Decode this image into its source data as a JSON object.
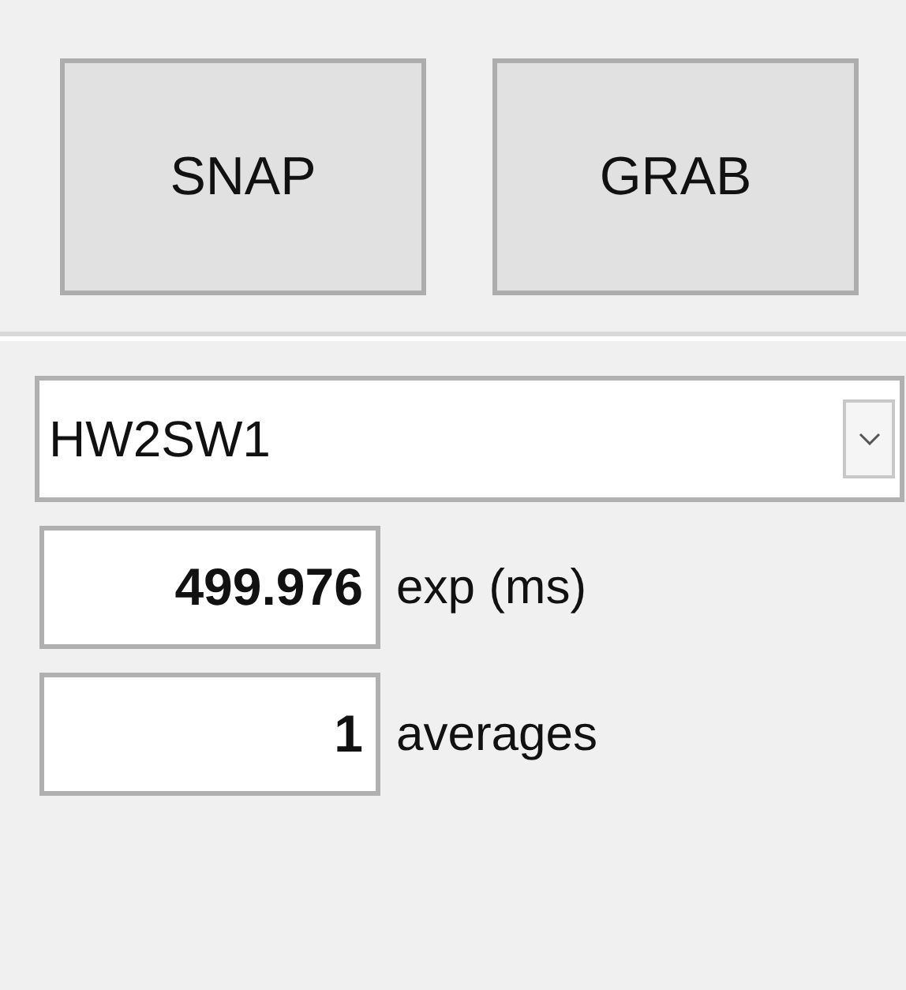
{
  "buttons": [
    {
      "label": "SNAP"
    },
    {
      "label": "GRAB"
    }
  ],
  "dropdown": {
    "value": "HW2SW1"
  },
  "fields": [
    {
      "value": "499.976",
      "label": "exp (ms)"
    },
    {
      "value": "1",
      "label": "averages"
    }
  ]
}
